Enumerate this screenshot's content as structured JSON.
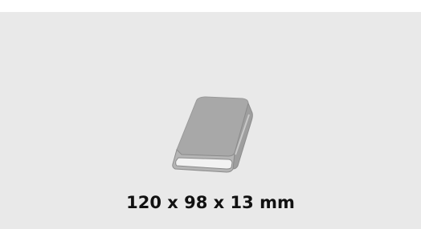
{
  "product": {
    "icon": "book-icon",
    "dimensions_label": "120 x 98 x 13 mm"
  },
  "colors": {
    "background": "#e9e9e9",
    "icon_fill": "#a8a8a8",
    "icon_edge": "#8c8c8c",
    "icon_pages": "#f2f2f2",
    "text": "#111111"
  }
}
